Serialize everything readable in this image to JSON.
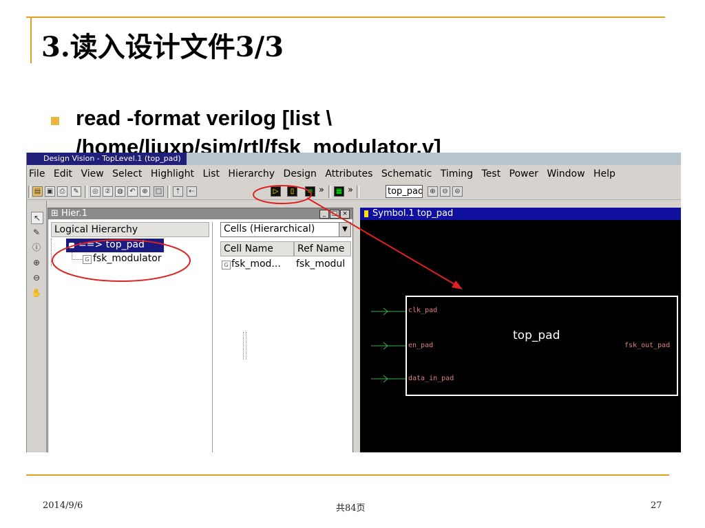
{
  "slide": {
    "title": "3.读入设计文件3/3",
    "bullet_line1": "read -format verilog  [list \\",
    "bullet_line2": "/home/liuxp/sim/rtl/fsk_modulator.v]",
    "footer_date": "2014/9/6",
    "footer_pages": "共84页",
    "footer_number": "27",
    "accent_color": "#e0a020",
    "bullet_color": "#e8b640"
  },
  "app": {
    "window_title": "Design Vision - TopLevel.1 (top_pad)",
    "menus": [
      "File",
      "Edit",
      "View",
      "Select",
      "Highlight",
      "List",
      "Hierarchy",
      "Design",
      "Attributes",
      "Schematic",
      "Timing",
      "Test",
      "Power",
      "Window",
      "Help"
    ],
    "toolbar": {
      "design_combo": "top_pad",
      "icons": [
        "open-icon",
        "save-icon",
        "print-icon",
        "edit-icon",
        "zoom-fit-icon",
        "zoom-2-icon",
        "zoom-area-icon",
        "zoom-prev-icon",
        "zoom-in-icon",
        "stop-icon",
        "push-up-icon",
        "pop-icon",
        "symbol-view-icon",
        "schematic-view-icon",
        "path-icon",
        "more-icon",
        "hierarchy-view-icon",
        "more-icon",
        "zoom-in-small-icon",
        "zoom-out-small-icon",
        "zoom-fit-small-icon"
      ],
      "overflow_label": "»"
    },
    "left_tools": [
      "pointer-icon",
      "pencil-icon",
      "info-icon",
      "zoom-in-icon",
      "zoom-out-icon",
      "hand-pan-icon"
    ],
    "hier_panel": {
      "title": "Hier.1",
      "tree_header": "Logical Hierarchy",
      "tree_items": [
        {
          "label": "==> top_pad",
          "selected": true
        },
        {
          "label": "fsk_modulator",
          "selected": false
        }
      ],
      "cells_dropdown": "Cells (Hierarchical)",
      "columns": [
        "Cell Name",
        "Ref Name"
      ],
      "rows": [
        {
          "cell": "fsk_mod...",
          "ref": "fsk_modul"
        }
      ]
    },
    "symbol_panel": {
      "title": "Symbol.1  top_pad",
      "block_name": "top_pad",
      "input_pins": [
        "clk_pad",
        "en_pad",
        "data_in_pad"
      ],
      "output_pins": [
        "fsk_out_pad"
      ],
      "pin_color": "#e08080",
      "wire_color": "#3cb043"
    }
  },
  "annotations": {
    "highlight_color": "#e02020"
  }
}
